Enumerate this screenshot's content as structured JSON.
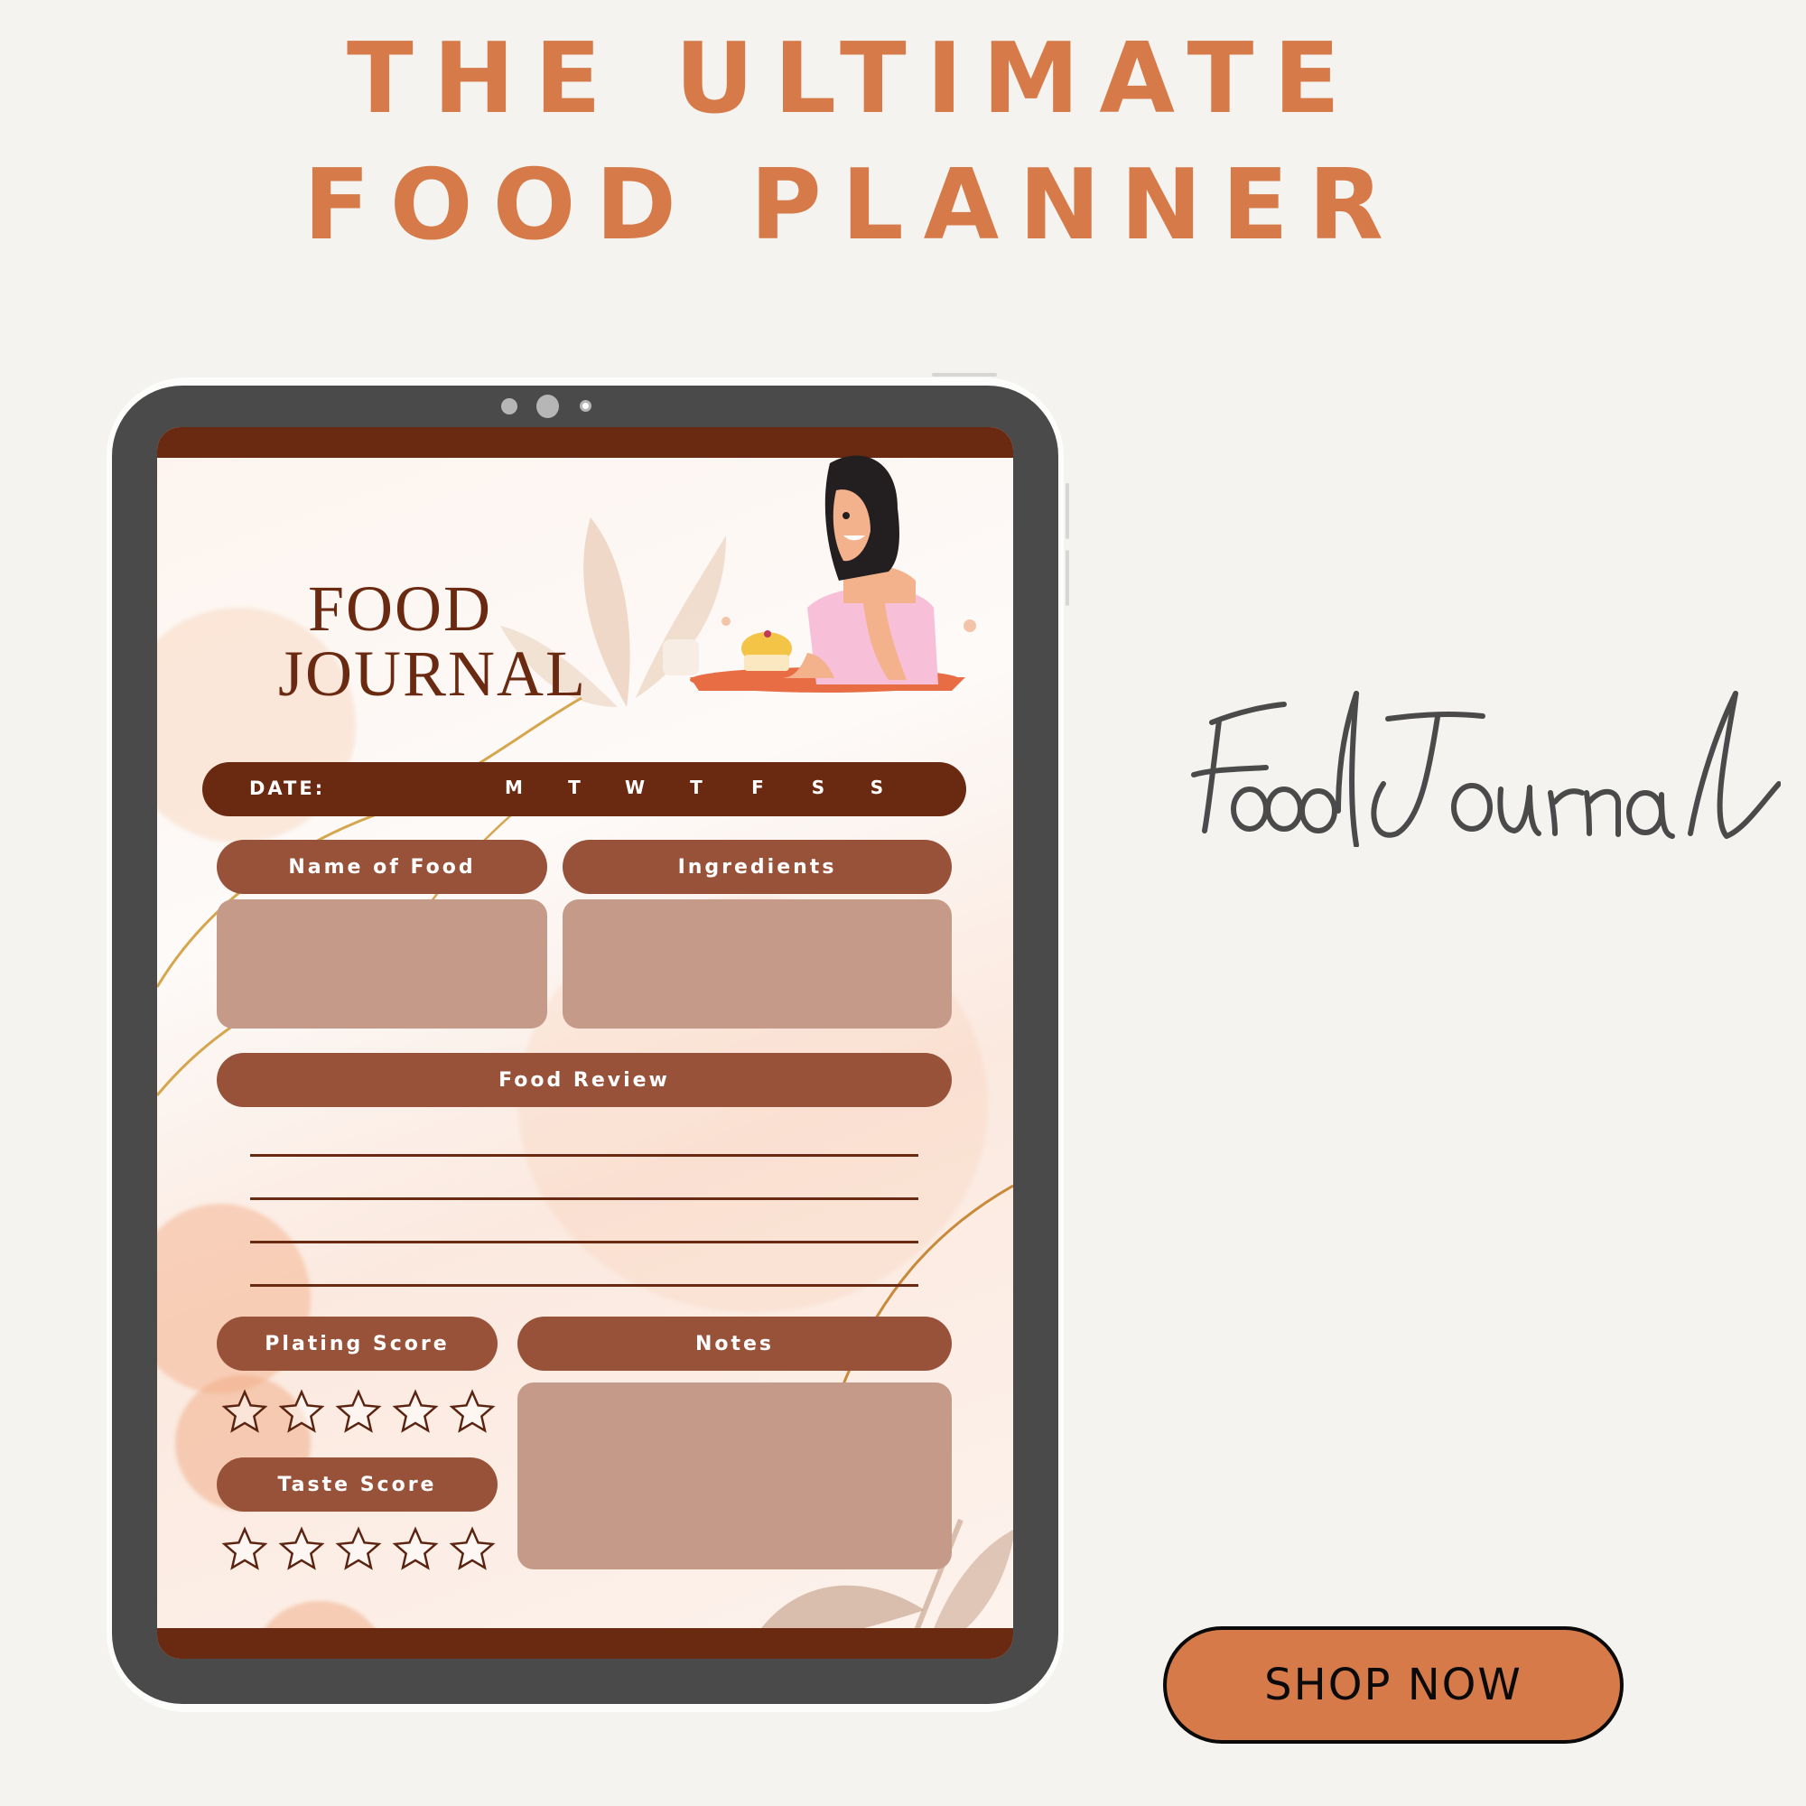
{
  "headline": {
    "line1": "THE ULTIMATE",
    "line2": "FOOD PLANNER"
  },
  "colors": {
    "accent": "#d57a48",
    "dark_brown": "#6a2a12",
    "pill_brown": "#98523a",
    "box_fill": "#c69a88",
    "tablet_body": "#4a4a4a",
    "background": "#f4f3ef"
  },
  "tablet": {
    "page": {
      "title_line1": "FOOD",
      "title_line2": "JOURNAL",
      "date_label": "DATE:",
      "days": [
        "M",
        "T",
        "W",
        "T",
        "F",
        "S",
        "S"
      ],
      "name_of_food_label": "Name of Food",
      "ingredients_label": "Ingredients",
      "food_review_label": "Food Review",
      "plating_score_label": "Plating Score",
      "taste_score_label": "Taste Score",
      "notes_label": "Notes",
      "plating_score": {
        "value": 0,
        "max": 5
      },
      "taste_score": {
        "value": 0,
        "max": 5
      },
      "review_lines": 4
    },
    "illustration": "woman-at-table-with-dessert"
  },
  "script_title": "Food Journal",
  "cta": {
    "label": "SHOP NOW"
  }
}
